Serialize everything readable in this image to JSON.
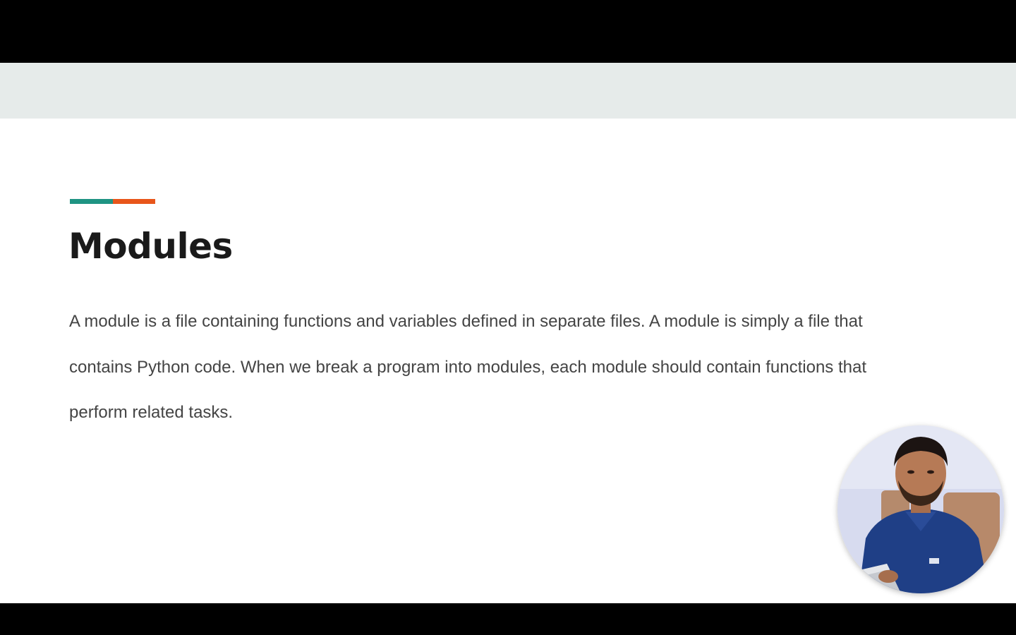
{
  "slide": {
    "title": "Modules",
    "body": "A module is a file containing functions and variables defined in separate files. A module is simply a file that contains Python code. When we break a program into modules, each module should contain functions that perform related tasks.",
    "accent_colors": {
      "teal": "#1f9483",
      "orange": "#e8561b"
    },
    "band_color": "#e6ebea"
  },
  "presenter_overlay": {
    "icon": "presenter-webcam"
  }
}
